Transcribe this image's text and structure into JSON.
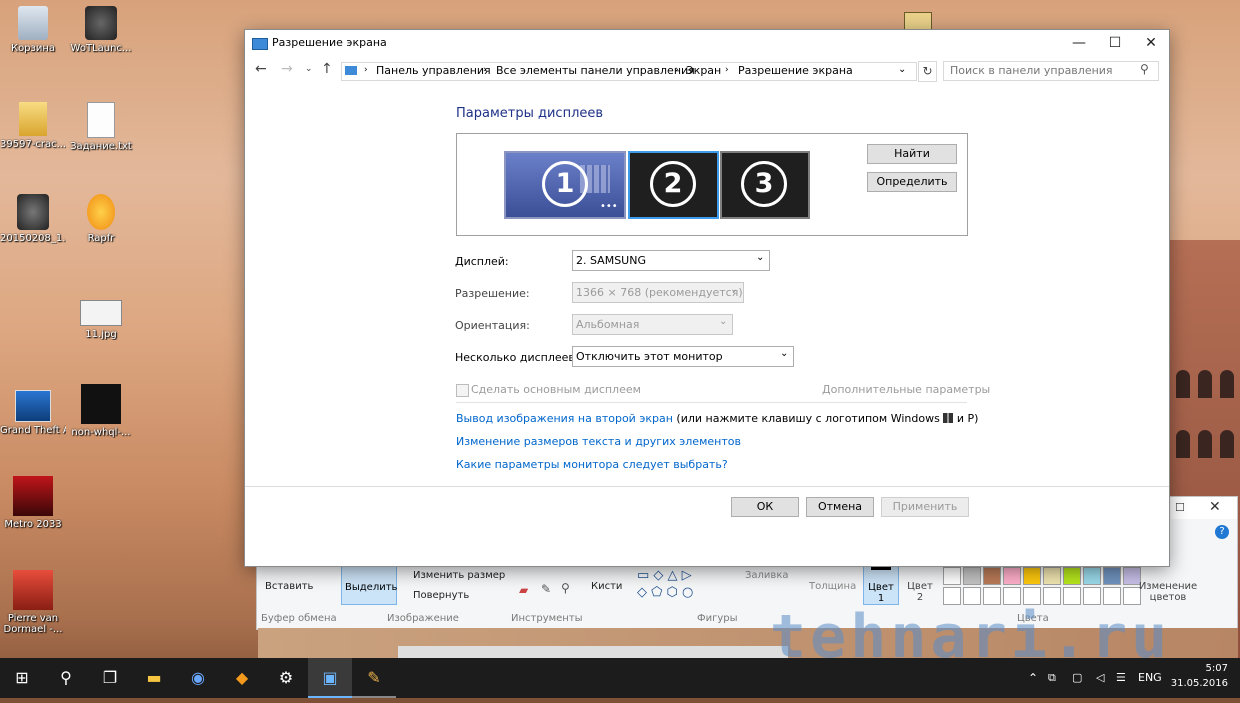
{
  "desktop": {
    "icons": [
      {
        "label": "Корзина"
      },
      {
        "label": "WoTLaunc..."
      },
      {
        "label": "39597-crac..."
      },
      {
        "label": "Задание.txt"
      },
      {
        "label": "20150208_1..."
      },
      {
        "label": "Rapfr"
      },
      {
        "label": "11.jpg"
      },
      {
        "label": "Grand Theft Auto IV"
      },
      {
        "label": "non-whql-..."
      },
      {
        "label": "Metro 2033"
      },
      {
        "label": "Pierre van Dormael -..."
      }
    ]
  },
  "dialog": {
    "title": "Разрешение экрана",
    "breadcrumb": [
      "Панель управления",
      "Все элементы панели управления",
      "Экран",
      "Разрешение экрана"
    ],
    "search_placeholder": "Поиск в панели управления",
    "heading": "Параметры дисплеев",
    "monitors": [
      "1",
      "2",
      "3"
    ],
    "find_label": "Найти",
    "identify_label": "Определить",
    "display_label": "Дисплей:",
    "display_value": "2. SAMSUNG",
    "resolution_label": "Разрешение:",
    "resolution_value": "1366 × 768 (рекомендуется)",
    "orientation_label": "Ориентация:",
    "orientation_value": "Альбомная",
    "multi_label": "Несколько дисплеев:",
    "multi_value": "Отключить этот монитор",
    "make_main_label": "Сделать основным дисплеем",
    "advanced_label": "Дополнительные параметры",
    "link1": "Вывод изображения на второй экран",
    "link1_suffix": "(или нажмите клавишу с логотипом Windows",
    "link1_end": "и P)",
    "link2": "Изменение размеров текста и других элементов",
    "link3": "Какие параметры монитора следует выбрать?",
    "ok_label": "ОК",
    "cancel_label": "Отмена",
    "apply_label": "Применить"
  },
  "paint": {
    "paste_label": "Вставить",
    "select_label": "Выделить",
    "resize_label": "Изменить размер",
    "rotate_label": "Повернуть",
    "brushes_label": "Кисти",
    "fill_label": "Заливка",
    "thickness_label": "Толщина",
    "color1_label": "Цвет 1",
    "color2_label": "Цвет 2",
    "edit_colors_label": "Изменение цветов",
    "group_clipboard": "Буфер обмена",
    "group_image": "Изображение",
    "group_tools": "Инструменты",
    "group_shapes": "Фигуры",
    "group_colors": "Цвета",
    "colors_row1": [
      "#ffffff",
      "#c3c3c3",
      "#b97a57",
      "#ffaec9",
      "#ffc90e",
      "#efe4b0",
      "#b5e61d",
      "#99d9ea",
      "#7092be",
      "#c8bfe7"
    ],
    "colors_row2": [
      "#ffffff",
      "#ffffff",
      "#ffffff",
      "#ffffff",
      "#ffffff",
      "#ffffff",
      "#ffffff",
      "#ffffff",
      "#ffffff",
      "#ffffff"
    ]
  },
  "taskbar": {
    "lang": "ENG",
    "time": "5:07",
    "date": "31.05.2016"
  },
  "watermark": "tehnari.ru"
}
